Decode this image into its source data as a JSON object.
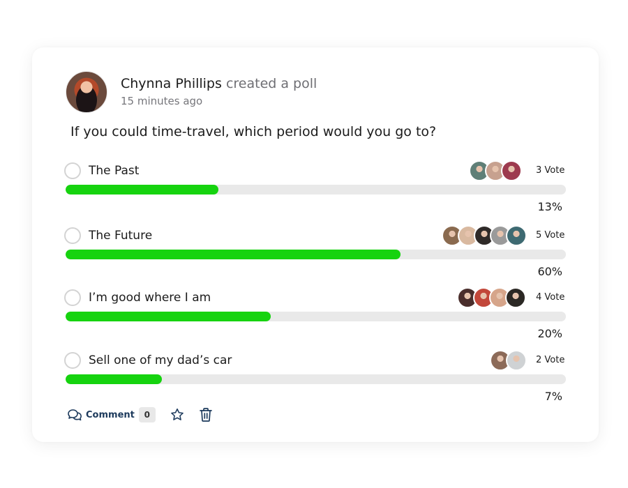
{
  "post": {
    "author_name": "Chynna Phillips",
    "action_text": "created a poll",
    "timestamp": "15 minutes ago",
    "question": "If you could time-travel, which period would you go to?"
  },
  "poll": {
    "accent_color": "#16d30f",
    "options": [
      {
        "label": "The Past",
        "votes_text": "3 Vote",
        "percent_text": "13%",
        "fill": 0.305,
        "voter_colors": [
          "#5f7f77",
          "#c7a18f",
          "#9d3a4e"
        ]
      },
      {
        "label": "The Future",
        "votes_text": "5 Vote",
        "percent_text": "60%",
        "fill": 0.67,
        "voter_colors": [
          "#8a6a4f",
          "#d9b9a0",
          "#2f2a28",
          "#9a9a9a",
          "#3e6a72"
        ]
      },
      {
        "label": "I’m good where I am",
        "votes_text": "4 Vote",
        "percent_text": "20%",
        "fill": 0.41,
        "voter_colors": [
          "#4a2e2c",
          "#c2473a",
          "#d6a58a",
          "#2b2824"
        ]
      },
      {
        "label": "Sell one of my dad’s car",
        "votes_text": "2 Vote",
        "percent_text": "7%",
        "fill": 0.192,
        "voter_colors": [
          "#8c6a58",
          "#cfd2d4"
        ]
      }
    ]
  },
  "footer": {
    "comment_label": "Comment",
    "comment_count": "0",
    "icons": [
      "comment-icon",
      "star-icon",
      "trash-icon"
    ]
  }
}
